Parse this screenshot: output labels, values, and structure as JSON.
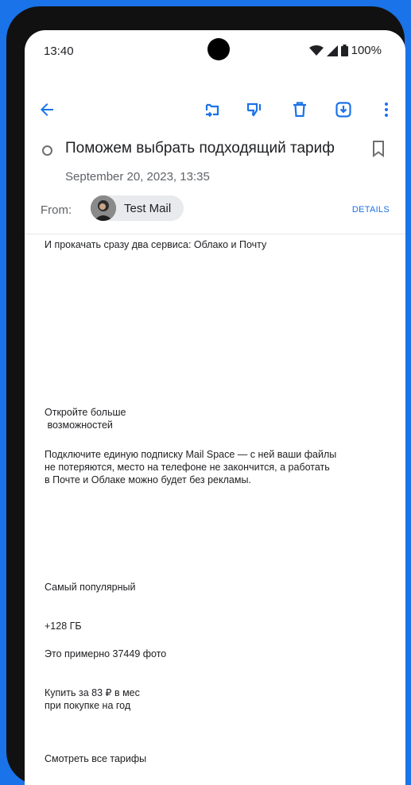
{
  "statusbar": {
    "time": "13:40",
    "battery": "100%"
  },
  "toolbar": {
    "icons": [
      "back-arrow-icon",
      "move-to-icon",
      "dislike-icon",
      "trash-icon",
      "archive-download-icon",
      "more-vert-icon"
    ]
  },
  "email": {
    "subject": "Поможем выбрать подходящий тариф",
    "date": "September 20, 2023, 13:35",
    "from_label": "From:",
    "sender": "Test Mail",
    "details_label": "DETAILS"
  },
  "body": {
    "intro": "И прокачать сразу два сервиса: Облако и Почту",
    "heading_line1": "Откройте больше",
    "heading_line2": " возможностей",
    "para_line1": "Подключите единую подписку Mail Space — с ней ваши файлы",
    "para_line2": "не потеряются, место на телефоне не закончится, а работать",
    "para_line3": "в Почте и Облаке можно будет без рекламы.",
    "popular": "Самый популярный",
    "storage": "+128 ГБ",
    "photos": "Это примерно 37449 фото",
    "buy_line1": "Купить за 83 ₽ в мес",
    "buy_line2": "при покупке на год",
    "all_plans": "Смотреть все тарифы"
  },
  "colors": {
    "accent": "#1a73e8",
    "frame_bg": "#1a73e8"
  }
}
